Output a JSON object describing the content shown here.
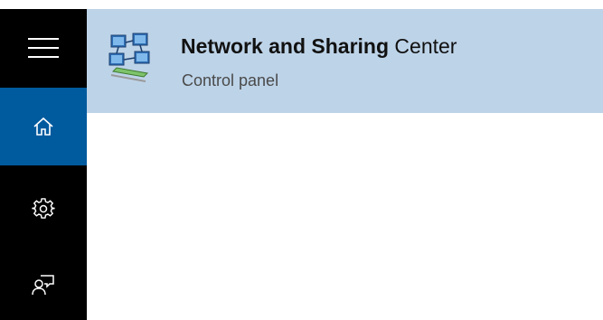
{
  "sidebar": {
    "items": [
      {
        "name": "menu",
        "icon": "hamburger-menu-icon"
      },
      {
        "name": "home",
        "icon": "home-icon",
        "selected": true
      },
      {
        "name": "settings",
        "icon": "gear-icon"
      },
      {
        "name": "feedback",
        "icon": "feedback-icon"
      }
    ],
    "background": "#000000",
    "selected_color": "#005a9e",
    "icon_color": "#ffffff"
  },
  "result": {
    "title_bold": "Network and Sharing",
    "title_rest": " Center",
    "subtitle": "Control panel",
    "icon": "network-and-sharing-center-icon",
    "highlight_color": "#bdd3e8"
  }
}
